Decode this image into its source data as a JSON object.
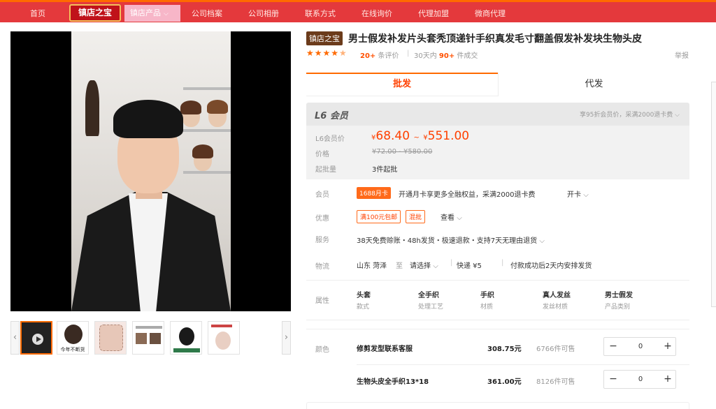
{
  "nav": {
    "home": "首页",
    "logo": "镇店之宝",
    "active_label": "镇店产品",
    "items": [
      "公司档案",
      "公司相册",
      "联系方式",
      "在线询价",
      "代理加盟",
      "微商代理"
    ]
  },
  "product": {
    "badge": "镇店之宝",
    "title": "男士假发补发片头套秃顶递针手织真发毛寸翻盖假发补发块生物头皮",
    "rating_stars": 4.5,
    "reviews_num": "20+",
    "reviews_suffix": "条评价",
    "sales_prefix": "30天内",
    "sales_num": "90+",
    "sales_suffix": "件成交",
    "report": "举报"
  },
  "tabs": [
    "批发",
    "代发"
  ],
  "member": {
    "level": "L6 会员",
    "note": "享95折会员价，采满2000退卡费",
    "price_label": "L6会员价",
    "price_low": "68.40",
    "price_high": "551.00",
    "currency": "¥",
    "sep": "~",
    "orig_label": "价格",
    "orig_range": "¥72.00 - ¥580.00",
    "moq_label": "起批量",
    "moq_value": "3件起批"
  },
  "rows": {
    "member_label": "会员",
    "card_tag": "1688月卡",
    "card_text": "开通月卡享更多全融权益，采满2000退卡费",
    "card_link": "开卡",
    "promo_label": "优惠",
    "promo_tags": [
      "满100元包邮",
      "混批"
    ],
    "promo_link": "查看",
    "service_label": "服务",
    "service_text": "38天免费赊账・48h发货・极速退款・支持7天无理由退货",
    "logistics_label": "物流",
    "origin": "山东 菏泽",
    "to": "至",
    "dest": "请选择",
    "express": "快递 ¥5",
    "ship_note": "付款成功后2天内安排发货"
  },
  "attributes": {
    "label": "属性",
    "items": [
      {
        "value": "头套",
        "key": "款式"
      },
      {
        "value": "全手织",
        "key": "处理工艺"
      },
      {
        "value": "手织",
        "key": "材质"
      },
      {
        "value": "真人发丝",
        "key": "发丝材质"
      },
      {
        "value": "男士假发",
        "key": "产品类别"
      }
    ]
  },
  "skus": {
    "label": "颜色",
    "items": [
      {
        "name": "修剪发型联系客服",
        "price": "308.75元",
        "stock": "6766件可售",
        "qty": "0"
      },
      {
        "name": "生物头皮全手织13*18",
        "price": "361.00元",
        "stock": "8126件可售",
        "qty": "0"
      }
    ]
  },
  "gallery": {
    "thumb_captions": [
      "",
      "今年不断货",
      "",
      "",
      "",
      ""
    ]
  },
  "colors": {
    "nav_bg": "#e4393c",
    "accent": "#ff6a00",
    "price": "#ff4000"
  }
}
